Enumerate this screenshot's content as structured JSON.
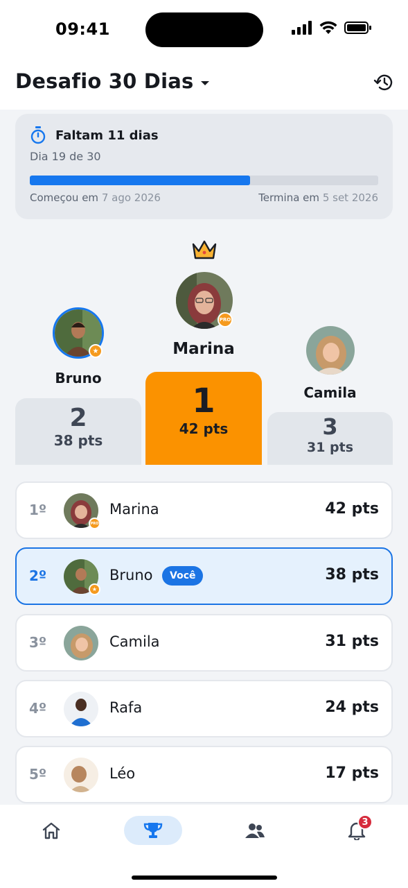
{
  "status_bar": {
    "time": "09:41"
  },
  "header": {
    "title": "Desafio 30 Dias",
    "dropdown_icon": "caret-down-icon",
    "history_icon": "history-icon"
  },
  "timer": {
    "icon": "stopwatch-icon",
    "title": "Faltam 11 dias",
    "subtitle": "Dia 19 de 30",
    "progress": 0.633,
    "start_label": "Começou em",
    "start_date": "7 ago 2026",
    "end_label": "Termina em",
    "end_date": "5 set 2026"
  },
  "podium": {
    "first": {
      "name": "Marina",
      "rank": "1",
      "points": "42 pts",
      "badge": "PRO"
    },
    "second": {
      "name": "Bruno",
      "rank": "2",
      "points": "38 pts"
    },
    "third": {
      "name": "Camila",
      "rank": "3",
      "points": "31 pts"
    }
  },
  "ranking": [
    {
      "position": "1º",
      "name": "Marina",
      "points": "42 pts",
      "badge": "PRO"
    },
    {
      "position": "2º",
      "name": "Bruno",
      "points": "38 pts",
      "you_label": "Você"
    },
    {
      "position": "3º",
      "name": "Camila",
      "points": "31 pts"
    },
    {
      "position": "4º",
      "name": "Rafa",
      "points": "24 pts"
    },
    {
      "position": "5º",
      "name": "Léo",
      "points": "17 pts"
    }
  ],
  "tabbar": {
    "items": [
      "home-icon",
      "trophy-icon",
      "people-icon",
      "bell-icon"
    ],
    "notification_count": "3"
  },
  "colors": {
    "accent": "#1677ee",
    "first_place": "#fb9200",
    "badge": "#f59a1e"
  }
}
